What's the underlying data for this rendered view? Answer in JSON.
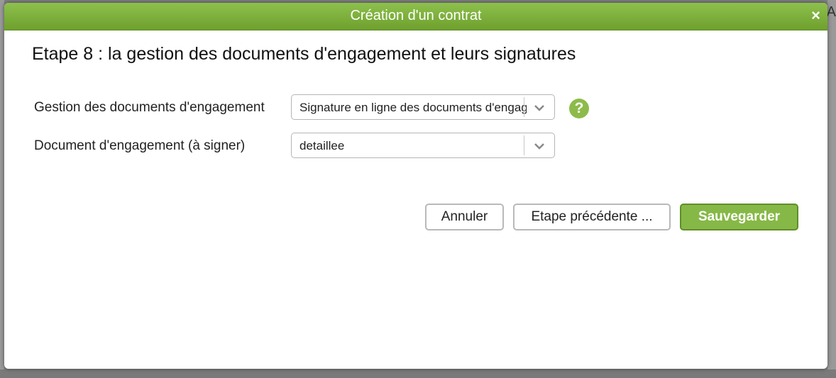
{
  "background": {
    "right_edge_letter": "A"
  },
  "dialog": {
    "title": "Création d'un contrat",
    "close_glyph": "×",
    "step_title": "Etape 8 : la gestion des documents d'engagement et leurs signatures",
    "fields": [
      {
        "label": "Gestion des documents d'engagement",
        "value": "Signature en ligne des documents d'engagement"
      },
      {
        "label": "Document d'engagement (à signer)",
        "value": "detaillee"
      }
    ],
    "help_glyph": "?",
    "buttons": {
      "cancel": "Annuler",
      "previous": "Etape précédente ...",
      "save": "Sauvegarder"
    }
  },
  "colors": {
    "accent_green": "#8dc04c",
    "save_button_green": "#86b847",
    "help_icon_green": "#8dbb4a"
  },
  "icons": {
    "close": "close-icon",
    "chevron": "chevron-down-icon",
    "help": "help-icon"
  }
}
